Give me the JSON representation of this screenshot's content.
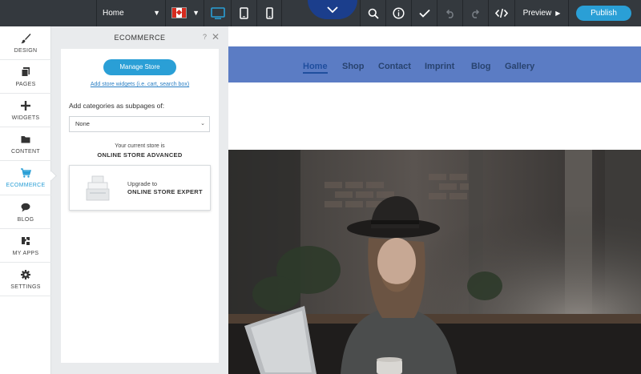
{
  "toolbar": {
    "page_select": "Home",
    "preview_label": "Preview",
    "publish_label": "Publish"
  },
  "icons": {
    "desktop": "desktop-icon",
    "tablet": "tablet-icon",
    "mobile": "mobile-icon",
    "collapse": "chevron-down-icon",
    "search": "search-icon",
    "info": "info-icon",
    "check": "check-icon",
    "undo": "undo-icon",
    "redo": "redo-icon",
    "code": "code-icon"
  },
  "colors": {
    "accent": "#2a9fd6",
    "toolbar": "#34393e",
    "site_nav": "#5b7cc4"
  },
  "sidebar": {
    "items": [
      {
        "label": "DESIGN",
        "icon": "brush-icon"
      },
      {
        "label": "PAGES",
        "icon": "pages-icon"
      },
      {
        "label": "WIDGETS",
        "icon": "plus-icon"
      },
      {
        "label": "CONTENT",
        "icon": "folder-icon"
      },
      {
        "label": "ECOMMERCE",
        "icon": "cart-icon"
      },
      {
        "label": "BLOG",
        "icon": "chat-icon"
      },
      {
        "label": "MY APPS",
        "icon": "apps-icon"
      },
      {
        "label": "SETTINGS",
        "icon": "gear-icon"
      }
    ],
    "active": "ECOMMERCE"
  },
  "panel": {
    "title": "ECOMMERCE",
    "help": "?",
    "manage_store": "Manage Store",
    "store_widgets_link": "Add store widgets (i.e. cart, search box)",
    "categories_label": "Add categories as subpages of:",
    "categories_value": "None",
    "current_store_text": "Your current store is",
    "current_store_name": "ONLINE STORE ADVANCED",
    "upgrade_to": "Upgrade to",
    "upgrade_name": "ONLINE STORE EXPERT"
  },
  "site": {
    "nav": [
      "Home",
      "Shop",
      "Contact",
      "Imprint",
      "Blog",
      "Gallery"
    ],
    "active": "Home"
  }
}
